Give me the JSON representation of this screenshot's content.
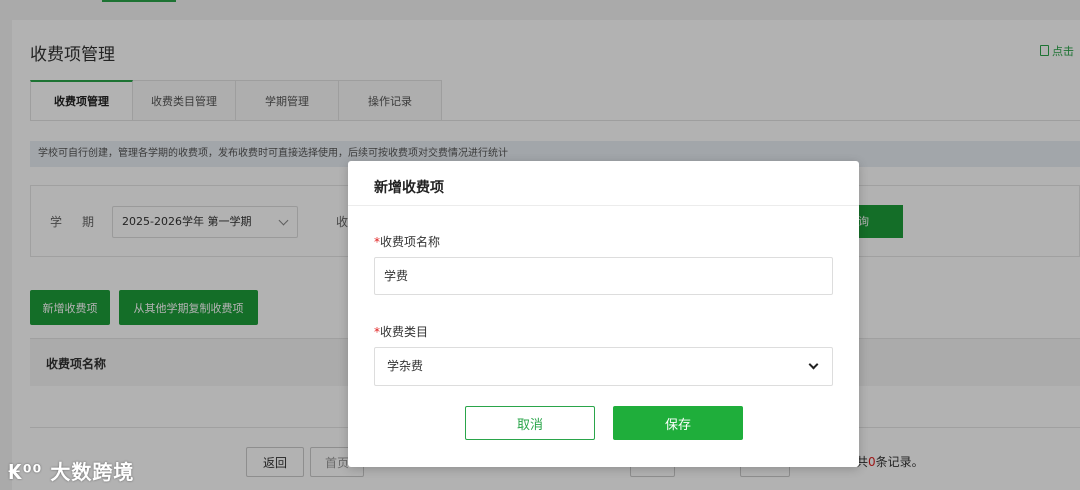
{
  "page": {
    "title": "收费项管理",
    "help_link": "点击"
  },
  "tabs": [
    {
      "label": "收费项管理",
      "active": true
    },
    {
      "label": "收费类目管理",
      "active": false
    },
    {
      "label": "学期管理",
      "active": false
    },
    {
      "label": "操作记录",
      "active": false
    }
  ],
  "notice": "学校可自行创建，管理各学期的收费项，发布收费时可直接选择使用，后续可按收费项对交费情况进行统计",
  "filter": {
    "term_label": "学期",
    "term_value": "2025-2026学年 第一学期",
    "fee_label_partial": "收",
    "search_button_partial": "询"
  },
  "actions": {
    "add_button": "新增收费项",
    "copy_button": "从其他学期复制收费项"
  },
  "table": {
    "columns": [
      "收费项名称"
    ]
  },
  "pager": {
    "back": "返回",
    "first": "首页",
    "records_prefix": "共",
    "records_count": "0",
    "records_suffix": "条记录。"
  },
  "watermark": "大数跨境",
  "modal": {
    "title": "新增收费项",
    "name_label": "收费项名称",
    "name_value": "学费",
    "category_label": "收费类目",
    "category_value": "学杂费",
    "required_mark": "*",
    "cancel_button": "取消",
    "save_button": "保存"
  },
  "colors": {
    "brand_green": "#1e9e3a",
    "required_red": "#e02020"
  }
}
